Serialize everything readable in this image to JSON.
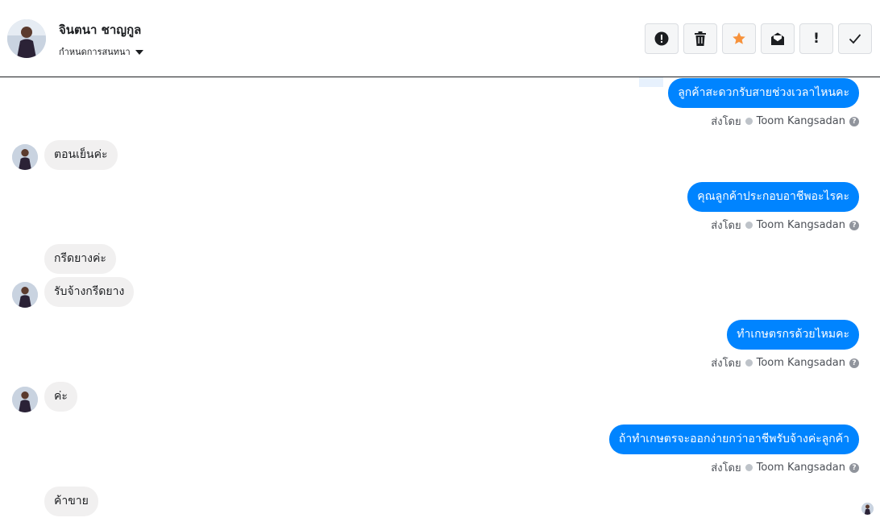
{
  "header": {
    "contact_name": "จินตนา ชาญกูล",
    "assign_label": "กำหนดการสนทนา",
    "toolbar": [
      {
        "name": "spam-button",
        "icon": "alert-circle-icon"
      },
      {
        "name": "delete-button",
        "icon": "trash-icon"
      },
      {
        "name": "star-button",
        "icon": "star-icon"
      },
      {
        "name": "mark-unread-button",
        "icon": "envelope-icon"
      },
      {
        "name": "follow-up-button",
        "icon": "exclamation-icon",
        "label": "!"
      },
      {
        "name": "done-button",
        "icon": "check-icon"
      }
    ],
    "star_color": "#f7923b"
  },
  "thread": {
    "sender_prefix": "ส่งโดย",
    "sender_name": "Toom Kangsadan",
    "help_glyph": "?",
    "messages": [
      {
        "dir": "out",
        "text": "ลูกค้าสะดวกรับสายช่วงเวลาไหนคะ"
      },
      {
        "dir": "in",
        "text": "ตอนเย็นค่ะ"
      },
      {
        "dir": "out",
        "text": "คุณลูกค้าประกอบอาชีพอะไรคะ"
      },
      {
        "dir": "in",
        "text": "กรีดยางค่ะ"
      },
      {
        "dir": "in",
        "text": "รับจ้างกรีดยาง"
      },
      {
        "dir": "out",
        "text": "ทำเกษตรกรด้วยไหมคะ"
      },
      {
        "dir": "in",
        "text": "ค่ะ"
      },
      {
        "dir": "out",
        "text": "ถ้าทำเกษตรจะออกง่ายกว่าอาชีพรับจ้างค่ะลูกค้า"
      },
      {
        "dir": "in",
        "text": "ค้าขาย"
      }
    ]
  },
  "colors": {
    "outgoing_bubble": "#0084ff",
    "incoming_bubble": "#f1f0f0"
  }
}
